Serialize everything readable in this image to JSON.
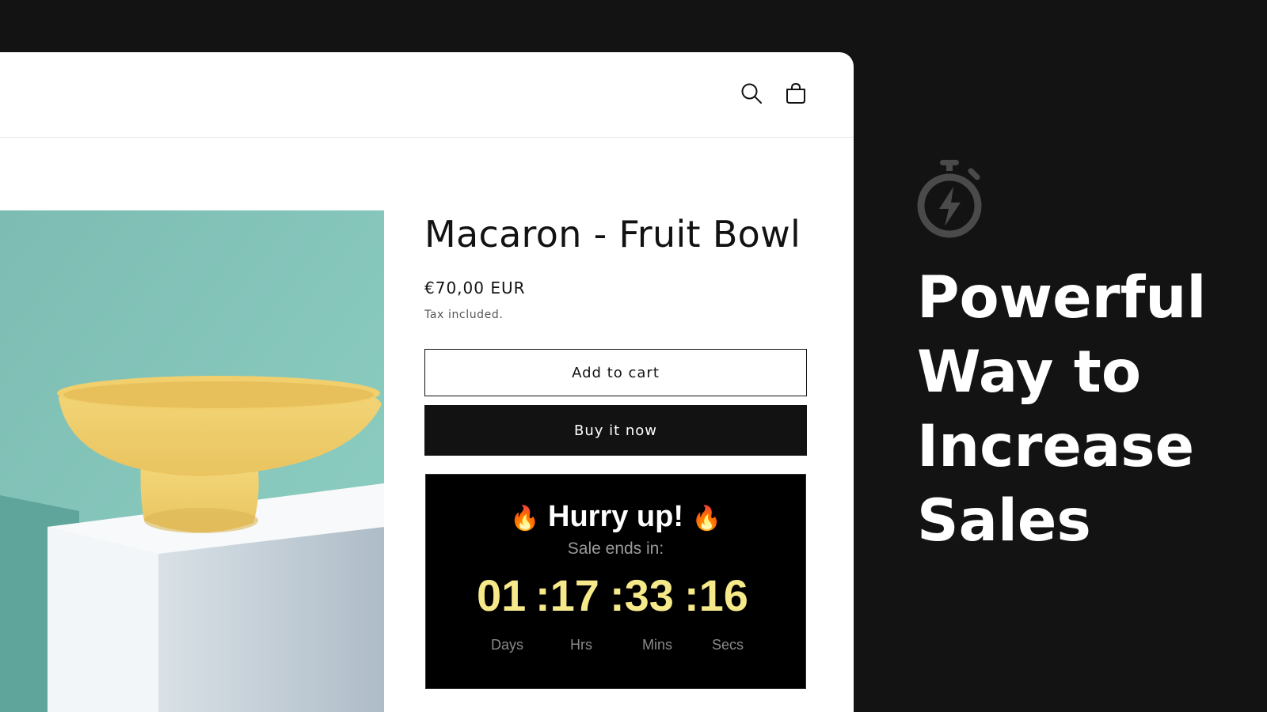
{
  "store": {
    "header": {
      "icons": [
        "search-icon",
        "cart-icon"
      ]
    },
    "product": {
      "title": "Macaron - Fruit Bowl",
      "price": "€70,00 EUR",
      "tax_note": "Tax included.",
      "add_to_cart_label": "Add to cart",
      "buy_now_label": "Buy it now"
    },
    "countdown": {
      "heading": "Hurry up!",
      "subheading": "Sale ends in:",
      "days": "01",
      "hours": ":17",
      "minutes": ":33",
      "seconds": ":16",
      "labels": {
        "days": "Days",
        "hours": "Hrs",
        "minutes": "Mins",
        "seconds": "Secs"
      },
      "colors": {
        "digits": "#f6e98a",
        "background": "#000000"
      }
    }
  },
  "promo": {
    "icon": "stopwatch-lightning-icon",
    "headline_lines": [
      "Powerful",
      "Way to",
      "Increase",
      "Sales"
    ]
  },
  "colors": {
    "page_background": "#131313",
    "store_background": "#ffffff",
    "button_dark": "#121212"
  }
}
